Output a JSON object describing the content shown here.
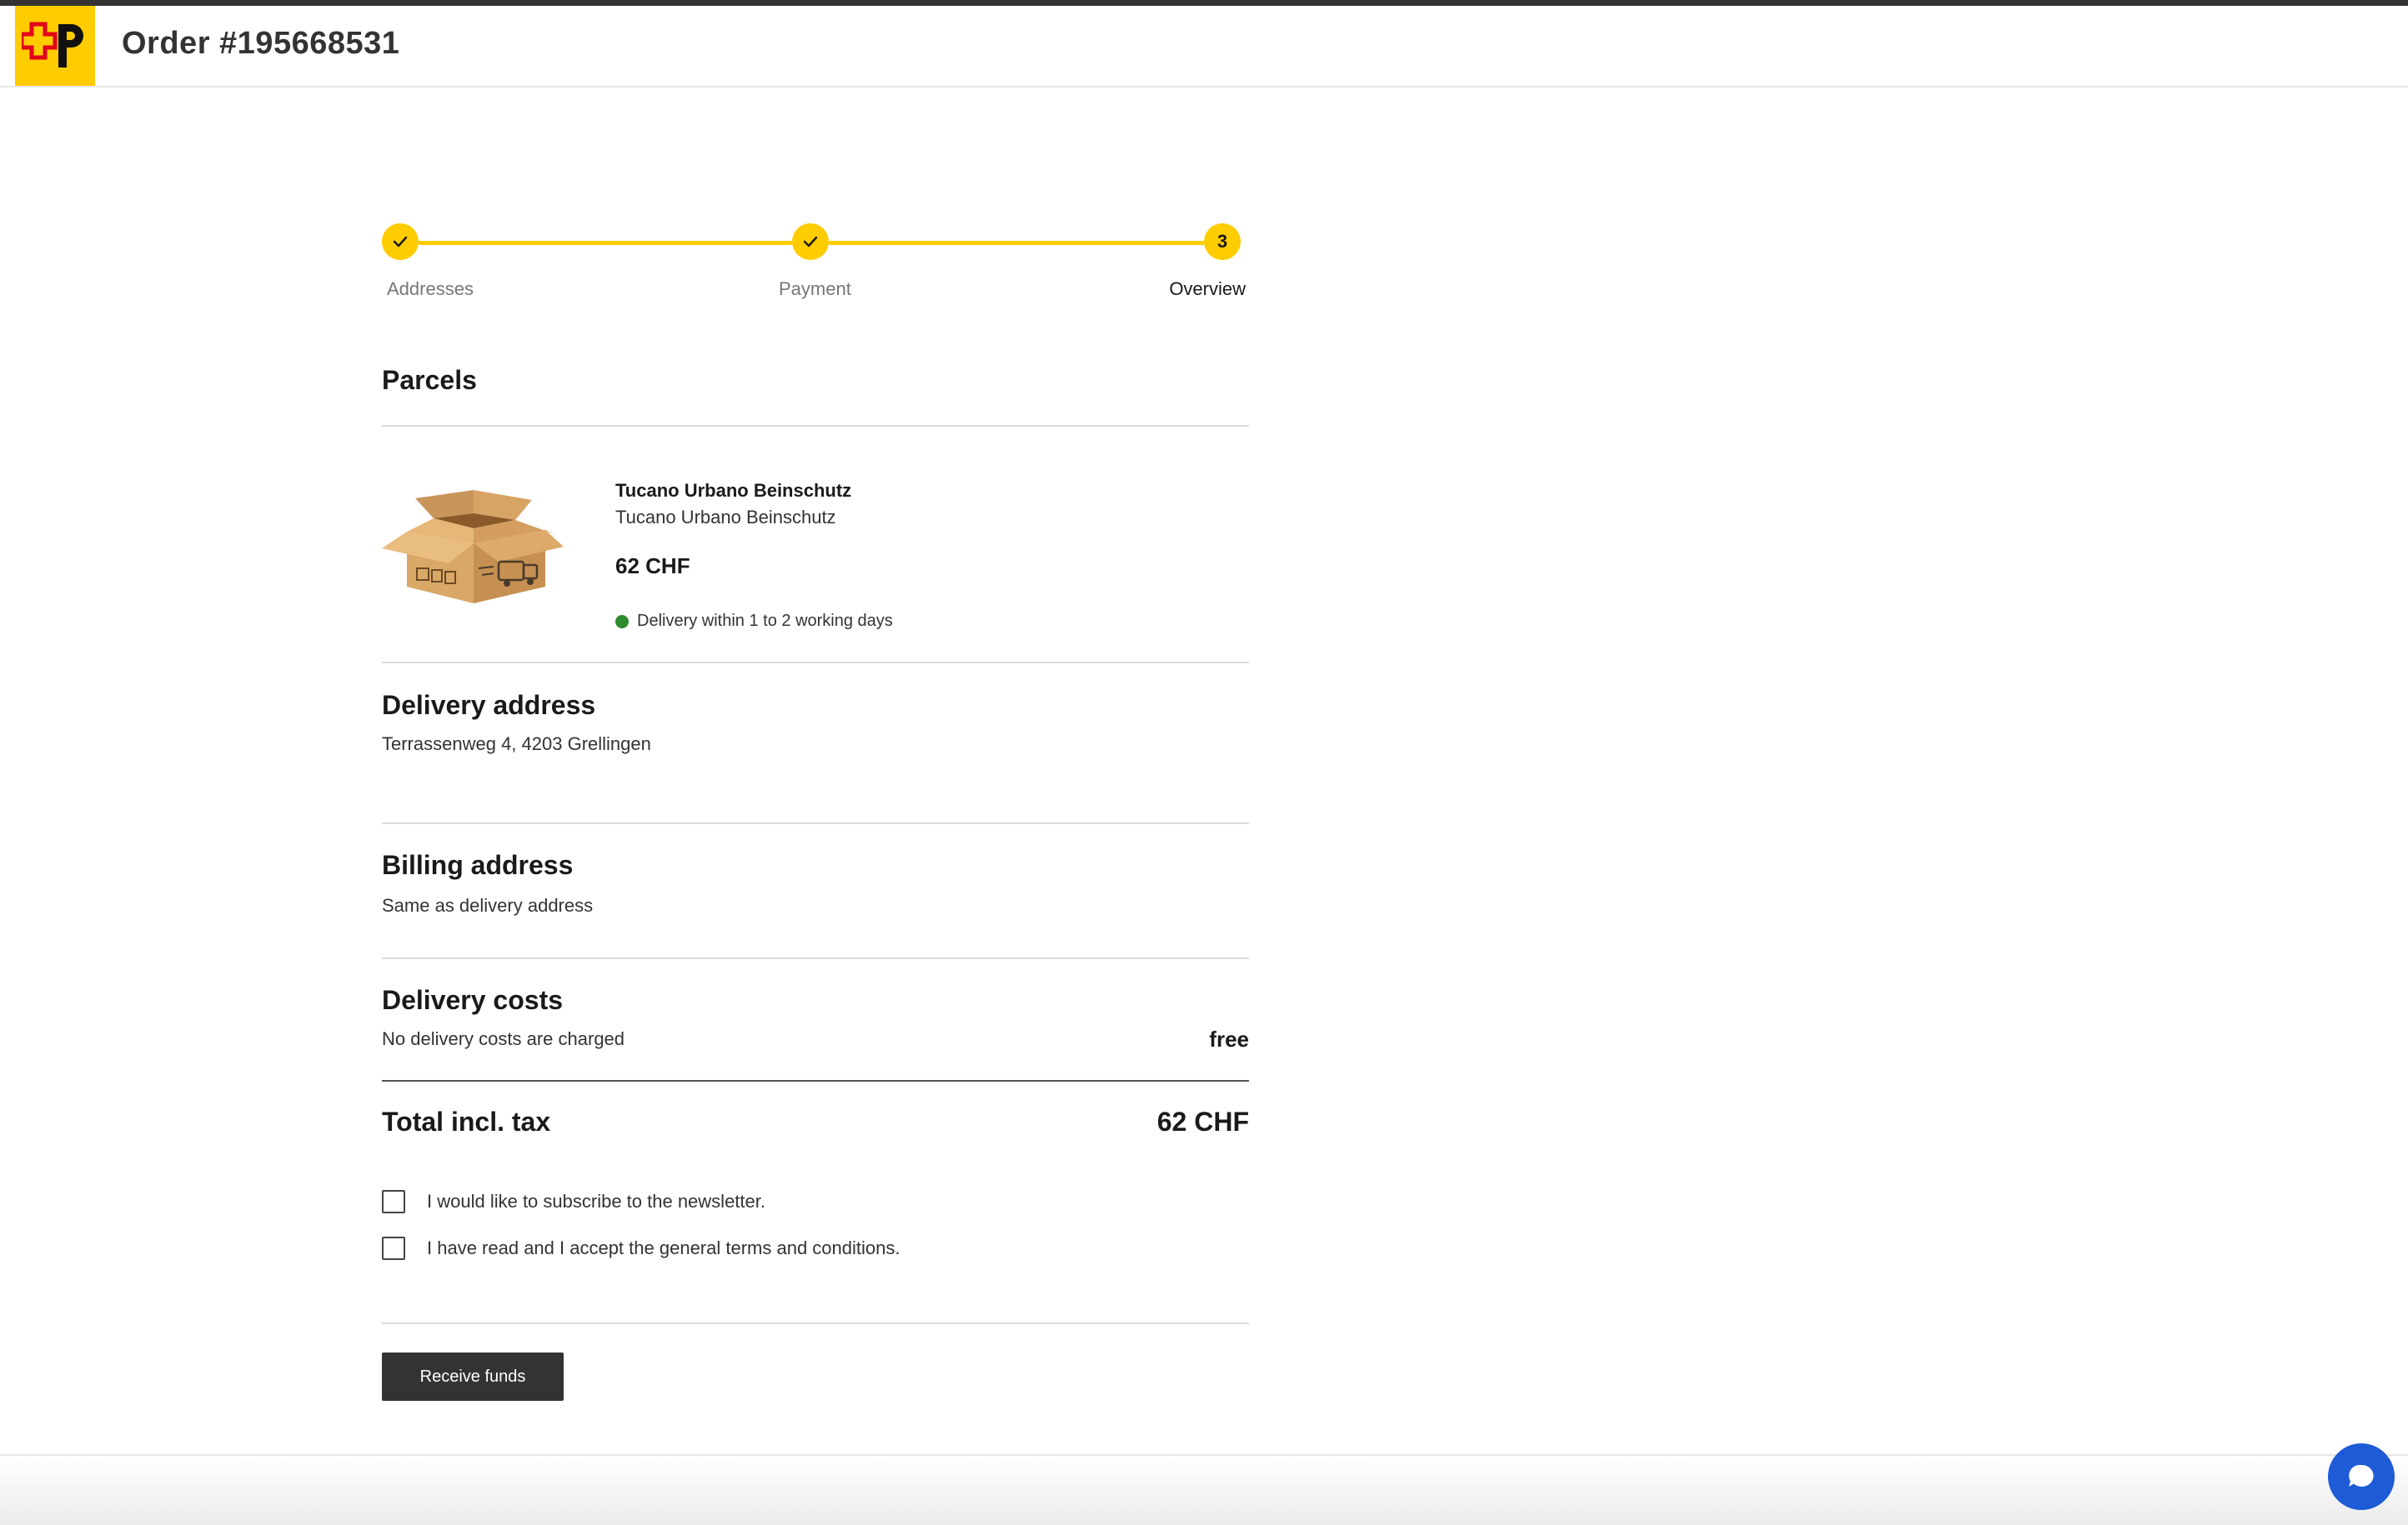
{
  "header": {
    "order_title": "Order #195668531"
  },
  "stepper": {
    "steps": [
      {
        "label": "Addresses",
        "state": "done"
      },
      {
        "label": "Payment",
        "state": "done"
      },
      {
        "label": "Overview",
        "state": "current",
        "number": "3"
      }
    ]
  },
  "parcels": {
    "title": "Parcels",
    "item": {
      "name": "Tucano Urbano Beinschutz",
      "subtitle": "Tucano Urbano Beinschutz",
      "price": "62 CHF",
      "delivery_note": "Delivery within 1 to 2 working days",
      "delivery_status_color": "#2e8b2e"
    }
  },
  "delivery_address": {
    "title": "Delivery address",
    "value": "Terrassenweg 4, 4203 Grellingen"
  },
  "billing_address": {
    "title": "Billing address",
    "value": "Same as delivery address"
  },
  "delivery_costs": {
    "title": "Delivery costs",
    "note": "No delivery costs are charged",
    "amount": "free"
  },
  "total": {
    "label": "Total incl. tax",
    "amount": "62 CHF"
  },
  "consents": {
    "newsletter": {
      "label": "I would like to subscribe to the newsletter.",
      "checked": false
    },
    "terms": {
      "label": "I have read and I accept the general terms and conditions.",
      "checked": false
    }
  },
  "actions": {
    "submit_label": "Receive funds"
  },
  "colors": {
    "brand_yellow": "#ffcc00",
    "button_dark": "#333333",
    "chat_blue": "#1e5bd6",
    "logo_red": "#e2001a"
  },
  "icons": {
    "logo": "swiss-post-logo",
    "step_done": "check-icon",
    "chat": "chat-bubble-icon"
  }
}
